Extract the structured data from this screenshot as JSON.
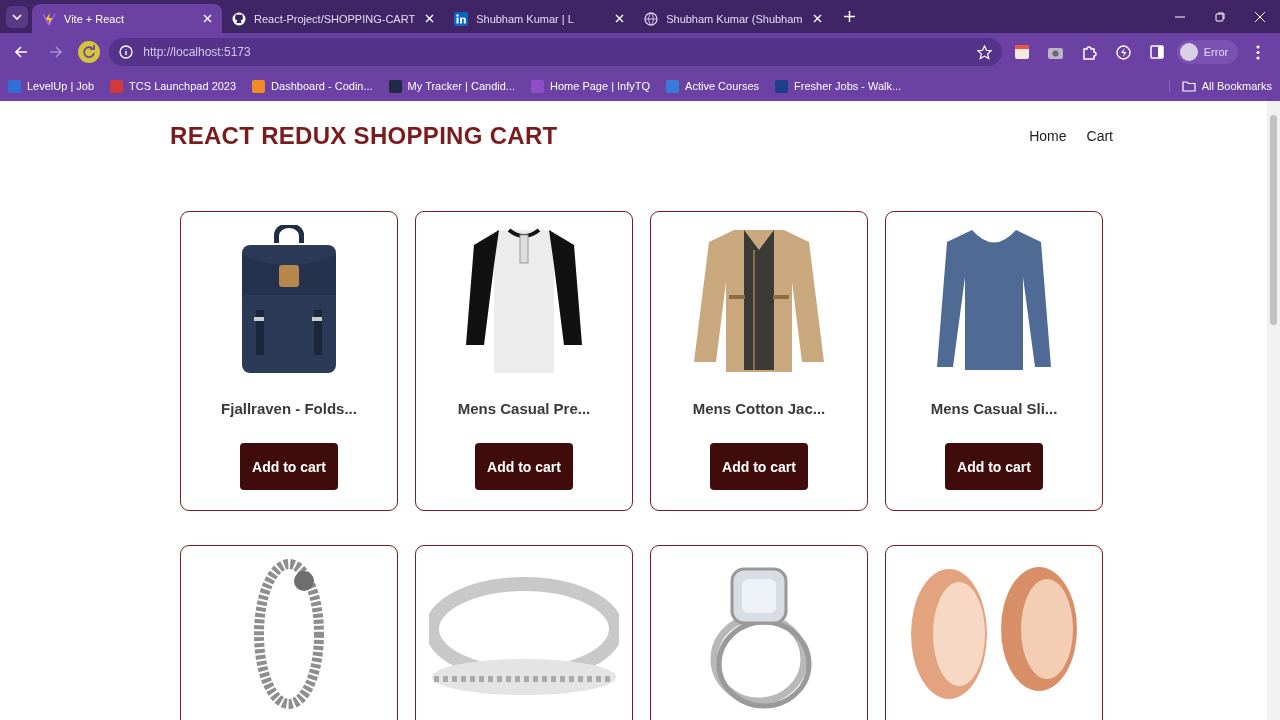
{
  "browser": {
    "tabs": [
      {
        "title": "Vite + React",
        "selected": true
      },
      {
        "title": "React-Project/SHOPPING-CART",
        "selected": false
      },
      {
        "title": "Shubham Kumar | L",
        "selected": false
      },
      {
        "title": "Shubham Kumar (Shubham",
        "selected": false
      }
    ],
    "url": "http://localhost:5173",
    "profile_label": "Error",
    "bookmarks": [
      {
        "label": "LevelUp | Job",
        "color": "#2f6fd6"
      },
      {
        "label": "TCS Launchpad 2023",
        "color": "#d23a3a"
      },
      {
        "label": "Dashboard - Codin...",
        "color": "#f08a24"
      },
      {
        "label": "My Tracker | Candid...",
        "color": "#1f2a44"
      },
      {
        "label": "Home Page | InfyTQ",
        "color": "#8e4fc8"
      },
      {
        "label": "Active Courses",
        "color": "#3a7bd5"
      },
      {
        "label": "Fresher Jobs - Walk...",
        "color": "#1d3f8a"
      }
    ],
    "all_bookmarks": "All Bookmarks"
  },
  "page": {
    "brand": "REACT REDUX SHOPPING CART",
    "nav": [
      {
        "label": "Home"
      },
      {
        "label": "Cart"
      }
    ],
    "products": [
      {
        "kind": "full",
        "title": "Fjallraven - Folds...",
        "button": "Add to cart"
      },
      {
        "kind": "full",
        "title": "Mens Casual Pre...",
        "button": "Add to cart"
      },
      {
        "kind": "full",
        "title": "Mens Cotton Jac...",
        "button": "Add to cart"
      },
      {
        "kind": "full",
        "title": "Mens Casual Sli...",
        "button": "Add to cart"
      },
      {
        "kind": "image-only"
      },
      {
        "kind": "image-only"
      },
      {
        "kind": "image-only"
      },
      {
        "kind": "image-only"
      }
    ]
  }
}
